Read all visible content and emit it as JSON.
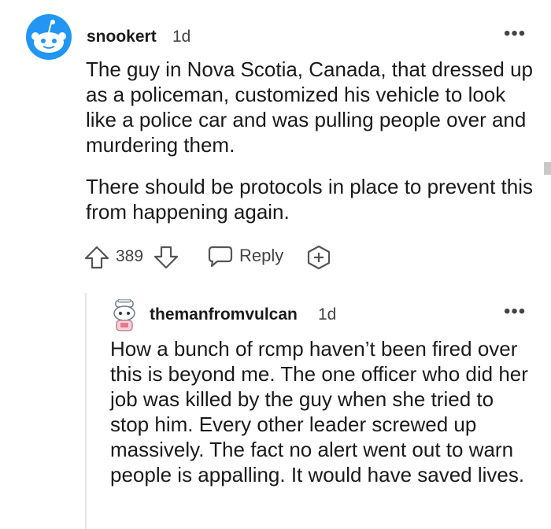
{
  "comments": [
    {
      "username": "snookert",
      "age": "1d",
      "more": "•••",
      "paragraphs": [
        "The guy in Nova Scotia, Canada, that dressed up as a policeman, customized his vehicle to look like a police car and was pulling people over and murdering them.",
        "There should be protocols in place to prevent this from happening again."
      ],
      "score": "389",
      "reply_label": "Reply"
    },
    {
      "username": "themanfromvulcan",
      "age": "1d",
      "more": "•••",
      "paragraphs": [
        "How a bunch of rcmp haven’t been fired over this is beyond me. The one officer who did her job was killed by the guy when she tried to stop him. Every other leader screwed up massively. The fact no alert went out to warn people is appalling. It would have saved lives."
      ]
    }
  ],
  "colors": {
    "avatar_blue": "#2196f3",
    "text": "#1a1a1b",
    "muted": "#444444"
  },
  "icons": {
    "upvote": "upvote-arrow-icon",
    "downvote": "downvote-arrow-icon",
    "reply": "speech-bubble-icon",
    "award": "award-plus-icon"
  }
}
